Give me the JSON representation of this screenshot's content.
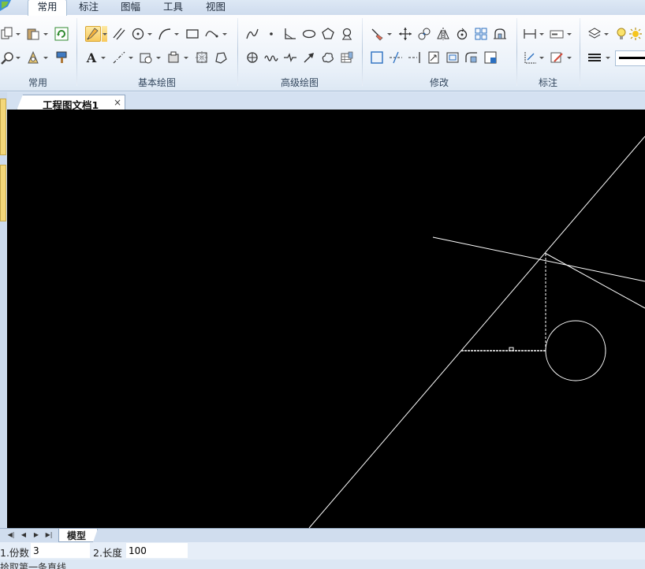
{
  "menu": {
    "tabs": [
      {
        "label": "常用",
        "active": true
      },
      {
        "label": "标注",
        "active": false
      },
      {
        "label": "图幅",
        "active": false
      },
      {
        "label": "工具",
        "active": false
      },
      {
        "label": "视图",
        "active": false
      }
    ]
  },
  "ribbon": {
    "groups": [
      "常用",
      "基本绘图",
      "高级绘图",
      "修改",
      "标注"
    ],
    "text_tool_label": "A"
  },
  "document": {
    "tab_title": "工程图文档1",
    "close_symbol": "×"
  },
  "bottom": {
    "nav_symbols": [
      "◀|",
      "◀",
      "▶",
      "▶|"
    ],
    "model_tab": "模型"
  },
  "command": {
    "param1_label": "1.份数",
    "param1_value": "3",
    "param2_label": "2.长度",
    "param2_value": "100"
  },
  "status": {
    "prompt": "拾取第一条直线"
  },
  "colors": {
    "canvas_bg": "#000000",
    "entity": "#ffffff",
    "highlight": "#f8c95c"
  }
}
